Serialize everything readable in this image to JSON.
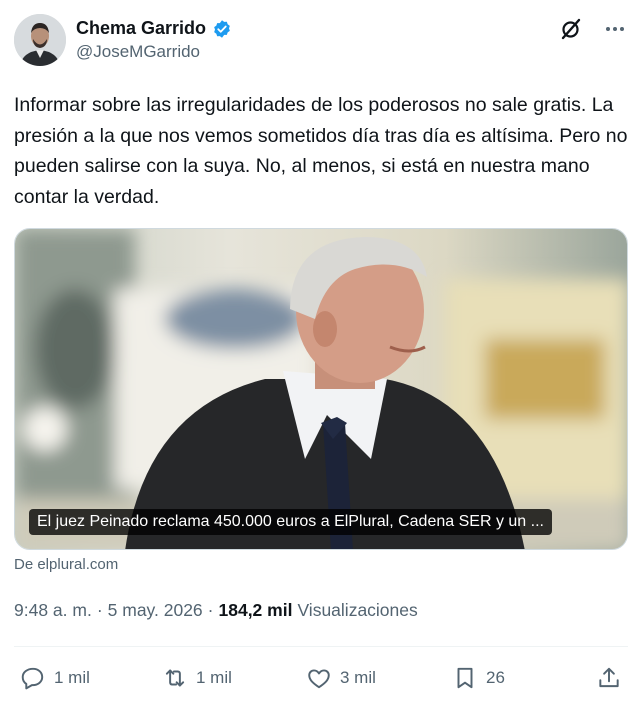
{
  "author": {
    "display_name": "Chema Garrido",
    "handle": "@JoseMGarrido",
    "verified": true
  },
  "icons": {
    "verified": "verified-badge-icon",
    "grok": "grok-icon",
    "more": "more-icon",
    "reply": "reply-icon",
    "repost": "repost-icon",
    "like": "like-icon",
    "bookmark": "bookmark-icon",
    "share": "share-icon"
  },
  "tweet": {
    "text": "Informar sobre las irregularidades de los poderosos no sale gratis. La presión a la que nos vemos sometidos día tras día es altísima. Pero no pueden salirse con la suya. No, al menos, si está en nuestra mano contar la verdad."
  },
  "card": {
    "title": "El juez Peinado reclama 450.000 euros a ElPlural, Cadena SER y un ...",
    "source": "De elplural.com"
  },
  "meta": {
    "time": "9:48 a. m.",
    "separator": "·",
    "date": "5 may. 2026",
    "views_count": "184,2 mil",
    "views_label": "Visualizaciones"
  },
  "actions": {
    "replies": "1 mil",
    "reposts": "1 mil",
    "likes": "3 mil",
    "bookmarks": "26"
  },
  "colors": {
    "text_primary": "#0f1419",
    "text_secondary": "#536471",
    "verified_blue": "#1d9bf0",
    "border": "#cfd9de",
    "divider": "#eff3f4"
  }
}
